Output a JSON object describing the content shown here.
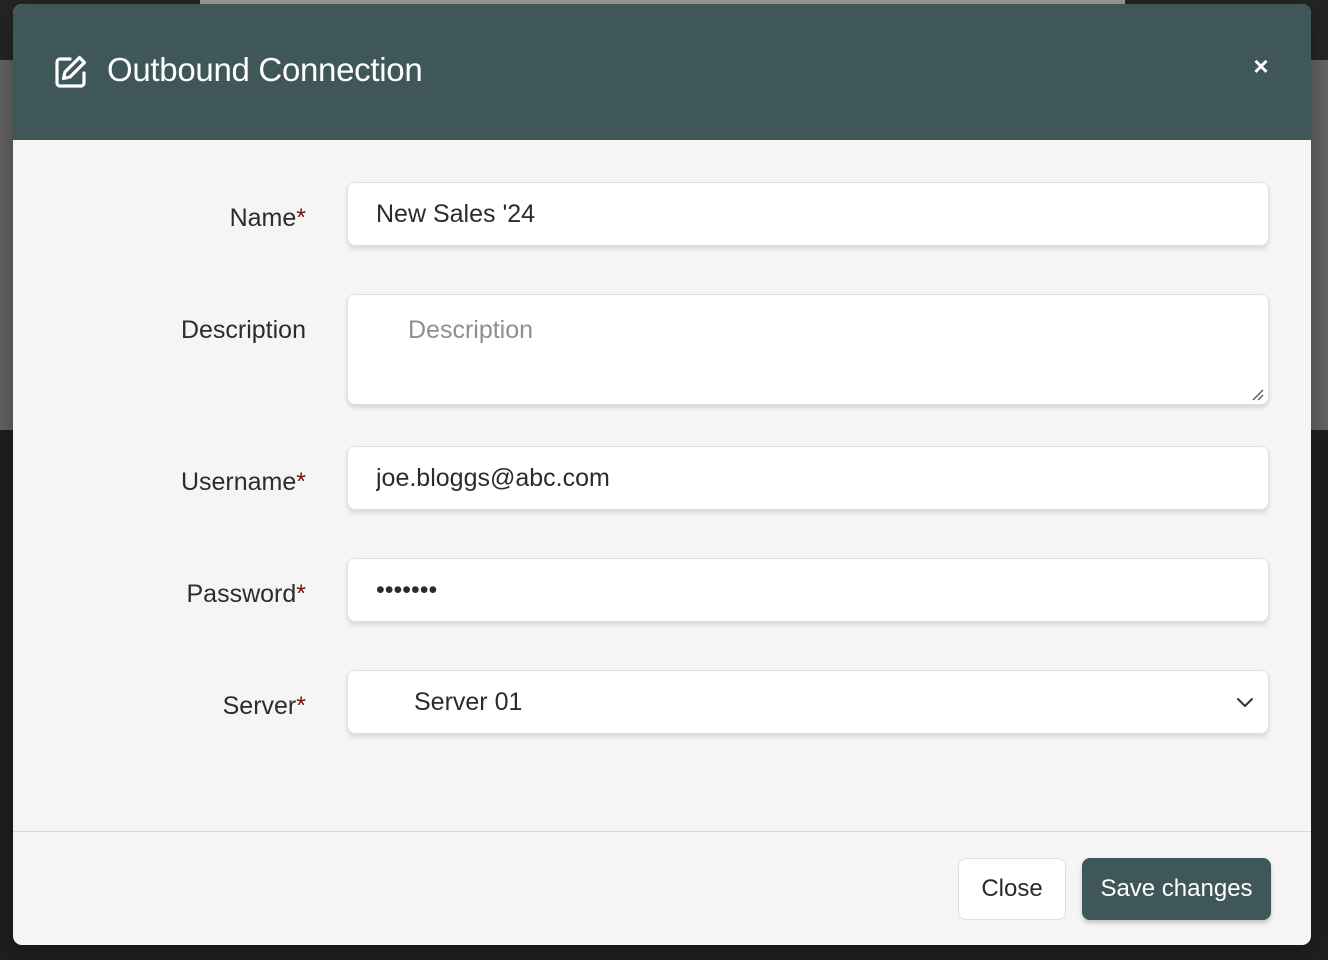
{
  "modal": {
    "title": "Outbound Connection",
    "header_icon": "edit-square-icon",
    "close_icon": "close-icon",
    "close_glyph": "×"
  },
  "form": {
    "name": {
      "label": "Name",
      "required_mark": "*",
      "value": "New Sales '24"
    },
    "description": {
      "label": "Description",
      "placeholder": "Description",
      "value": ""
    },
    "username": {
      "label": "Username",
      "required_mark": "*",
      "value": "joe.bloggs@abc.com"
    },
    "password": {
      "label": "Password",
      "required_mark": "*",
      "value": "passwor"
    },
    "server": {
      "label": "Server",
      "required_mark": "*",
      "selected": "Server 01",
      "chevron_icon": "chevron-down-icon"
    }
  },
  "footer": {
    "close_label": "Close",
    "save_label": "Save changes"
  },
  "colors": {
    "header_bg": "#3f5759",
    "primary_button": "#3f5759",
    "required_mark": "#7a1515",
    "body_bg": "#f5f5f5"
  }
}
